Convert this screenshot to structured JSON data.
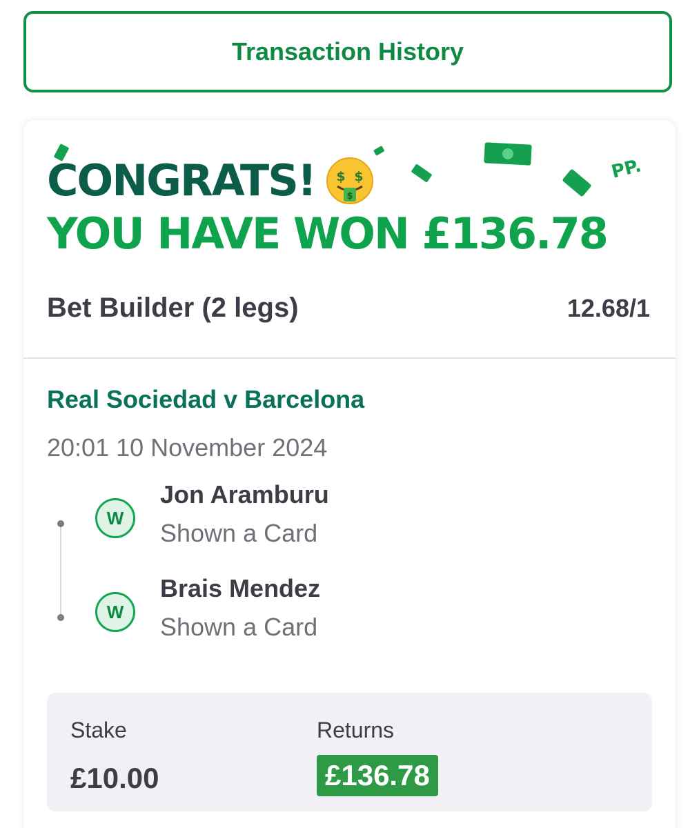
{
  "header": {
    "transaction_history_label": "Transaction History"
  },
  "win_banner": {
    "congrats": "CONGRATS!",
    "won_message": "YOU HAVE WON £136.78",
    "logo_text": "PP.",
    "emoji": "money-mouth-face"
  },
  "bet": {
    "type": "Bet Builder (2 legs)",
    "odds": "12.68/1",
    "event": "Real Sociedad v Barcelona",
    "datetime": "20:01 10 November 2024",
    "legs": [
      {
        "result": "W",
        "selection": "Jon Aramburu",
        "market": "Shown a Card"
      },
      {
        "result": "W",
        "selection": "Brais Mendez",
        "market": "Shown a Card"
      }
    ]
  },
  "summary": {
    "stake_label": "Stake",
    "stake_value": "£10.00",
    "returns_label": "Returns",
    "returns_value": "£136.78"
  },
  "colors": {
    "brand_green": "#119146",
    "dark_teal": "#0b5c49",
    "bright_green": "#10a34d",
    "returns_badge": "#2e9a46"
  }
}
